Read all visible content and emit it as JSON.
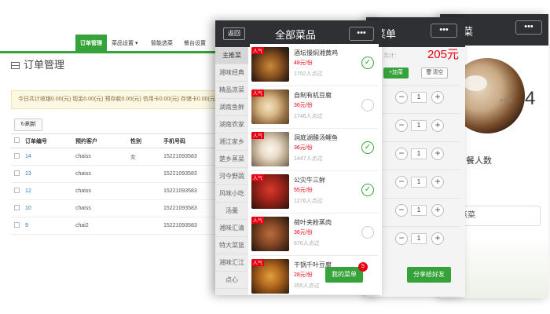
{
  "admin": {
    "nav": [
      {
        "label": "订单管理",
        "active": true
      },
      {
        "label": "菜品设置 ▾",
        "active": false
      },
      {
        "label": "智能选菜",
        "active": false
      },
      {
        "label": "餐台设置",
        "active": false
      }
    ],
    "page_title": "订单管理",
    "stats": "今日共计收银0.00(元) 现金0.00(元) 预存款0.00(元) 信用卡0.00(元) 存储卡0.00(元)",
    "refresh_label": "刷新",
    "table": {
      "headers": [
        "订单编号",
        "预约客户",
        "性别",
        "手机号码"
      ],
      "rows": [
        [
          "14",
          "chaiss",
          "女",
          "15221093583"
        ],
        [
          "13",
          "chaiss",
          "",
          "15221093583"
        ],
        [
          "12",
          "chaiss",
          "",
          "15221093583"
        ],
        [
          "10",
          "chaiss",
          "",
          "15221093583"
        ],
        [
          "9",
          "chai2",
          "",
          "15221093583"
        ]
      ]
    }
  },
  "flow": {
    "title": "点菜",
    "dots": "•••",
    "step_arrow": "• • >",
    "step_num": "4",
    "diners_label": "用餐人数",
    "order_input": "点菜"
  },
  "menu": {
    "title": "菜单",
    "dots": "•••",
    "total_label": "共计：",
    "total_value": "205元",
    "add_label": "+加菜",
    "clear_label": "清空",
    "quantities": [
      "1",
      "1",
      "1",
      "1",
      "1",
      "1"
    ],
    "share_label": "分享给好友"
  },
  "phone": {
    "back_label": "返回",
    "title": "全部菜品",
    "dots": "•••",
    "categories": [
      "主推菜",
      "湘味经典",
      "精品凉菜",
      "湖南鱼鲜",
      "湖南农家",
      "湘江家乡",
      "楚乡蒸菜",
      "河今野蔬",
      "风味小吃",
      "汤羹",
      "湘味汇清",
      "特大菜篮",
      "湘味汇江",
      "点心"
    ],
    "dishes": [
      {
        "tag": "人气",
        "name": "酒坛慢焖湘黄鸡",
        "price": "48元/份",
        "count": "1752人点过",
        "checked": true
      },
      {
        "tag": "人气",
        "name": "自制有机豆腐",
        "price": "36元/份",
        "count": "1746人点过",
        "checked": false
      },
      {
        "tag": "人气",
        "name": "洞庭湖醋汤鲤鱼",
        "price": "36元/份",
        "count": "1447人点过",
        "checked": true
      },
      {
        "tag": "人气",
        "name": "公灾牛三鲜",
        "price": "55元/份",
        "count": "1276人点过",
        "checked": true
      },
      {
        "tag": "人气",
        "name": "荷叶夹粉蒸肉",
        "price": "36元/份",
        "count": "670人点过",
        "checked": false
      },
      {
        "tag": "人气",
        "name": "干锅千叶豆腐",
        "price": "28元/份",
        "count": "355人点过",
        "checked": false
      }
    ],
    "my_menu_label": "我的菜单",
    "my_menu_count": "5"
  },
  "colors": {
    "brand_green": "#35a33a",
    "price_red": "#e60012",
    "header_dark": "#2f3033"
  }
}
